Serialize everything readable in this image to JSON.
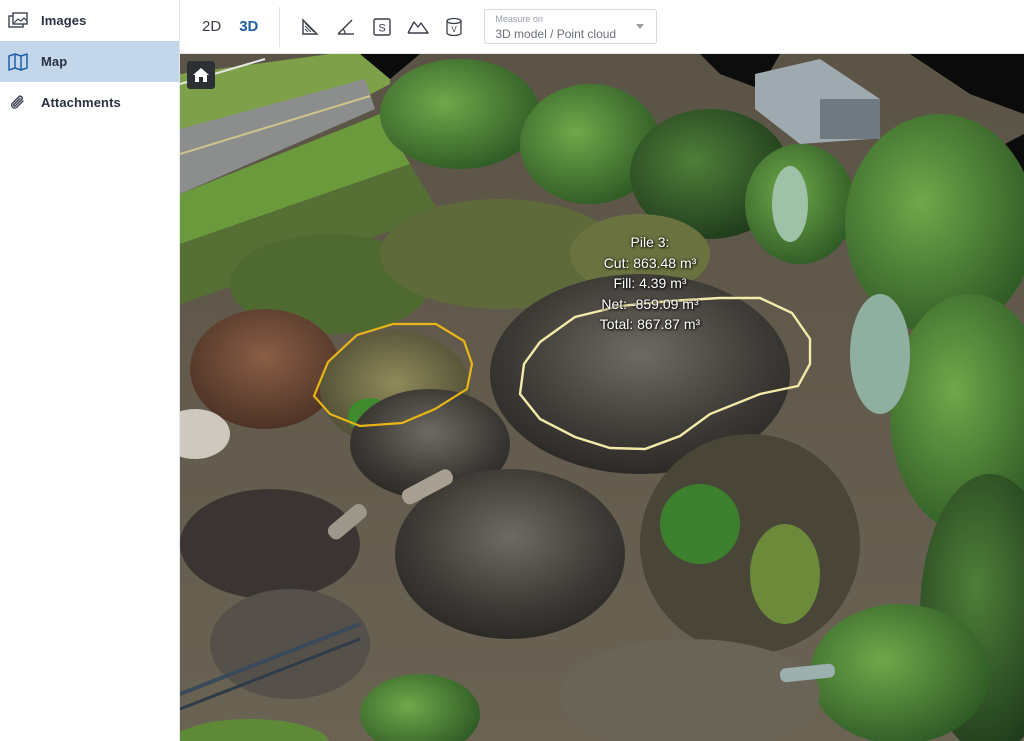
{
  "sidebar": {
    "items": [
      {
        "label": "Images",
        "icon": "images-icon",
        "active": false
      },
      {
        "label": "Map",
        "icon": "map-icon",
        "active": true
      },
      {
        "label": "Attachments",
        "icon": "paperclip-icon",
        "active": false
      }
    ]
  },
  "toolbar": {
    "view_2d": "2D",
    "view_3d": "3D",
    "active_view": "3D",
    "tools": [
      "area-measure-icon",
      "angle-measure-icon",
      "surface-measure-icon",
      "volume-measure-icon",
      "cylinder-volume-icon"
    ],
    "measure_on": {
      "label": "Measure on",
      "value": "3D model / Point cloud"
    }
  },
  "viewport": {
    "home_icon": "home-icon",
    "pile": {
      "name": "Pile 3:",
      "cut": "Cut: 863.48 m³",
      "fill": "Fill: 4.39 m³",
      "net": "Net: -859.09 m³",
      "total": "Total: 867.87 m³"
    }
  },
  "colors": {
    "accent": "#1f5fa8",
    "active_nav_bg": "#c4d7ea",
    "selection_outline_pile3": "#f3e9a8",
    "selection_outline_other": "#e8b517"
  }
}
